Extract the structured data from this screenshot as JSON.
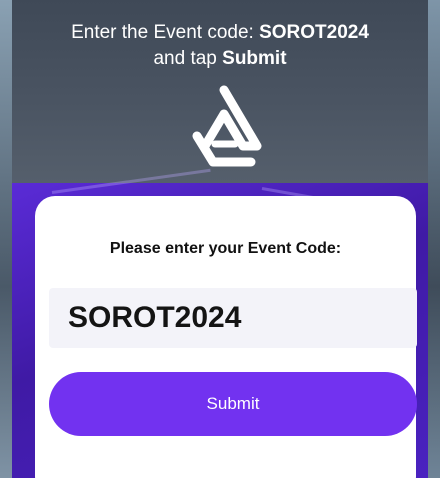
{
  "instructions": {
    "line1_prefix": "Enter the Event code: ",
    "line1_code": "SOROT2024",
    "line2_prefix": "and tap ",
    "line2_action": "Submit"
  },
  "logo": {
    "icon": "brand-triangle-logo-icon"
  },
  "card": {
    "prompt": "Please enter your Event Code:",
    "code_value": "SOROT2024",
    "submit_label": "Submit"
  },
  "colors": {
    "header_bg": "#4a5462",
    "purple_bg": "#4a22c0",
    "accent_button": "#7232f0",
    "input_bg": "#f3f3f9",
    "card_bg": "#ffffff"
  }
}
